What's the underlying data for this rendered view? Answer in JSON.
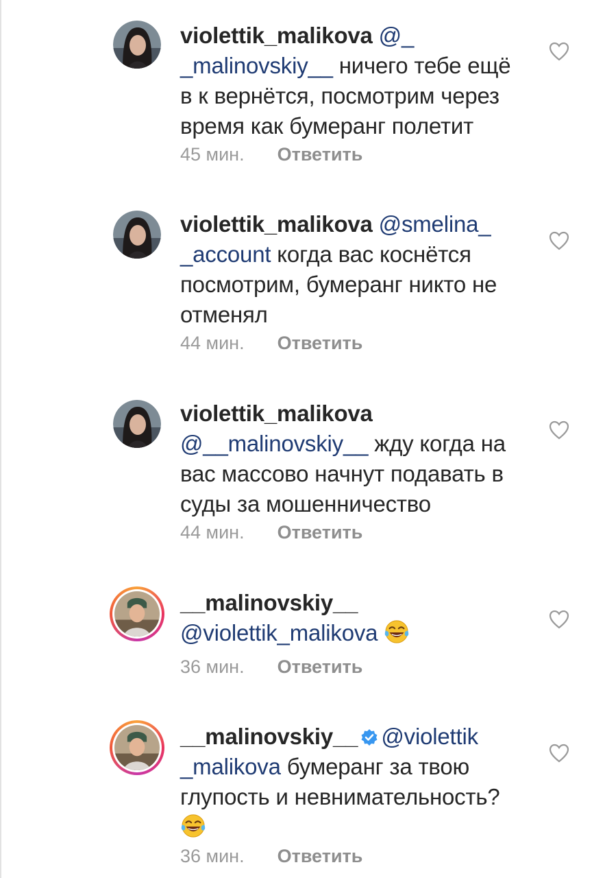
{
  "comments": [
    {
      "username": "violettik_malikova",
      "mention": "@_ _malinovskiy__",
      "text": " ничего тебе ещё в к вернётся, посмотрим через время как бумеранг полетит",
      "time": "45 мин.",
      "reply": "Ответить",
      "avatar": "woman-avatar"
    },
    {
      "username": "violettik_malikova",
      "mention": "@smelina_ _account",
      "text": " когда вас коснётся посмотрим, бумеранг никто не отменял",
      "time": "44 мин.",
      "reply": "Ответить",
      "avatar": "woman-avatar"
    },
    {
      "username": "violettik_malikova",
      "mention": "@__malinovskiy__",
      "text": " жду когда на вас массово начнут подавать в суды за мошенничество",
      "time": "44 мин.",
      "reply": "Ответить",
      "avatar": "woman-avatar"
    },
    {
      "username": "__malinovskiy__",
      "mention": "@violettik_malikova",
      "text": "",
      "time": "36 мин.",
      "reply": "Ответить",
      "avatar": "man-avatar",
      "emoji": "tears-of-joy-emoji"
    },
    {
      "username": "__malinovskiy__",
      "mention": "@violettik _malikova",
      "text": " бумеранг за твою глупость и невнимательность?",
      "time": "36 мин.",
      "reply": "Ответить",
      "avatar": "man-avatar",
      "verified": true,
      "emoji": "tears-of-joy-emoji"
    }
  ],
  "colors": {
    "mention": "#1f3b73",
    "meta": "#9a9a9a",
    "verified": "#3897f0",
    "story_ring": [
      "#f9a13a",
      "#e9345f",
      "#c838a8"
    ]
  }
}
